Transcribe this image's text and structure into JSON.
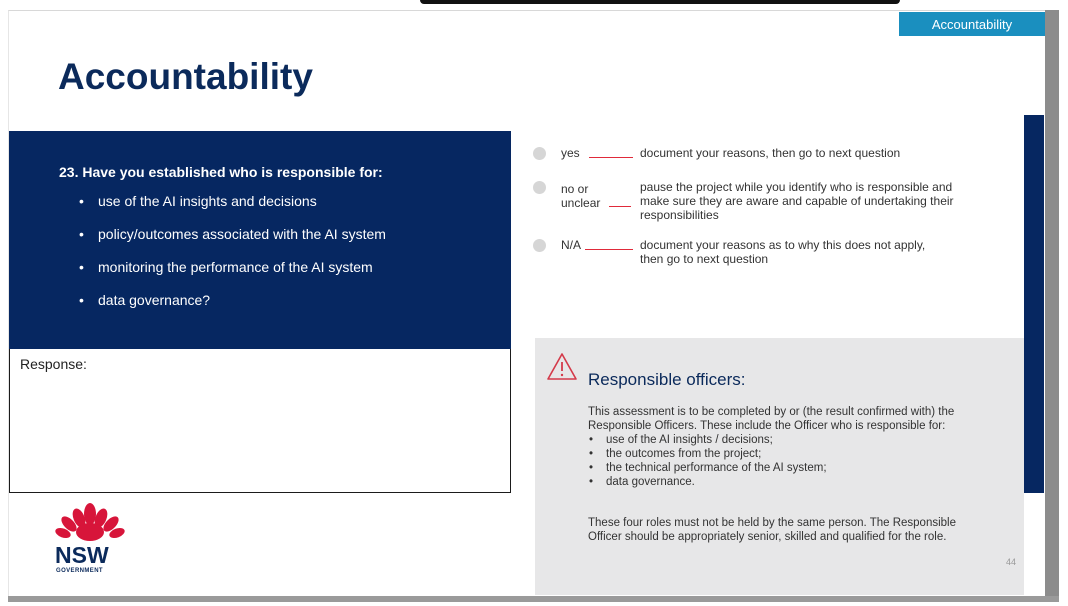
{
  "header": {
    "tag": "Accountability",
    "title": "Accountability"
  },
  "question": {
    "text": "23. Have you established who is responsible for:",
    "items": [
      "use of the AI insights and decisions",
      "policy/outcomes associated with the AI system",
      "monitoring the performance of the AI system",
      "data governance?"
    ]
  },
  "response": {
    "label": "Response:"
  },
  "options": [
    {
      "label": "yes",
      "description": "document your reasons, then go to next question"
    },
    {
      "label": "no or unclear",
      "label_line1": "no or",
      "label_line2": "unclear",
      "description_line1": "pause the project while you identify who is responsible and",
      "description_line2": "make sure they are aware and capable of undertaking their",
      "description_line3": "responsibilities"
    },
    {
      "label": "N/A",
      "description_line1": "document your reasons as to why this does not apply,",
      "description_line2": "then go to next question"
    }
  ],
  "info": {
    "icon": "warning-triangle-icon",
    "title": "Responsible officers:",
    "intro_line1": "This assessment is to be completed by or (the result confirmed with) the",
    "intro_line2": "Responsible Officers. These include the Officer who is responsible for:",
    "items": [
      "use of the AI insights / decisions;",
      "the outcomes from the project;",
      "the technical performance of the AI system;",
      "data governance."
    ],
    "closing_line1": "These four roles must not be held by the same person. The Responsible",
    "closing_line2": "Officer should be appropriately senior, skilled and qualified for the role."
  },
  "footer": {
    "page_number": "44"
  },
  "logo": {
    "name": "NSW",
    "subtitle": "GOVERNMENT",
    "icon": "waratah-flower-icon"
  },
  "colors": {
    "navy": "#062761",
    "accent_blue": "#1a8fbf",
    "red": "#e02a3a",
    "panel_grey": "#e7e7e8"
  }
}
